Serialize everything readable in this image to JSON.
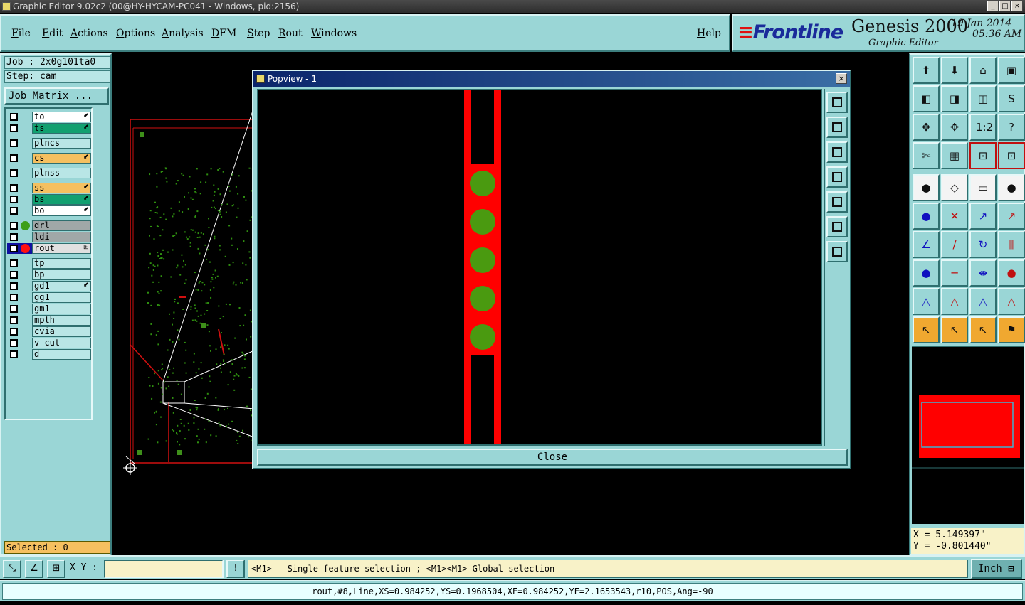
{
  "window": {
    "title": "Graphic Editor 9.02c2 (00@HY-HYCAM-PC041 - Windows, pid:2156)",
    "buttons": [
      "_",
      "□",
      "×"
    ]
  },
  "menu": {
    "items": [
      "File",
      "Edit",
      "Actions",
      "Options",
      "Analysis",
      "DFM",
      "Step",
      "Rout",
      "Windows"
    ],
    "help": "Help"
  },
  "brand": {
    "logo": "Frontline",
    "product": "Genesis 2000",
    "subtitle": "Graphic Editor",
    "date": "19 Jan 2014",
    "time": "05:36 AM"
  },
  "job": {
    "job_label": "Job : 2x0g101ta0",
    "step_label": "Step: cam",
    "matrix_button": "Job Matrix ...",
    "selected": "Selected : 0"
  },
  "layers": [
    {
      "name": "to",
      "color": "#ffffff",
      "mark": "⬋"
    },
    {
      "name": "ts",
      "color": "#12a070",
      "mark": "⬋"
    },
    {
      "name": "plncs",
      "color": "#b9e6e6",
      "mark": ""
    },
    {
      "name": "cs",
      "color": "#f5c060",
      "mark": "⬋"
    },
    {
      "name": "plnss",
      "color": "#b9e6e6",
      "mark": ""
    },
    {
      "name": "ss",
      "color": "#f5c060",
      "mark": "⬋"
    },
    {
      "name": "bs",
      "color": "#12a070",
      "mark": "⬋"
    },
    {
      "name": "bo",
      "color": "#ffffff",
      "mark": "⬋"
    },
    {
      "name": "drl",
      "color": "#a0a8a8",
      "mark": ""
    },
    {
      "name": "ldi",
      "color": "#a0a8a8",
      "mark": ""
    },
    {
      "name": "rout",
      "color": "#e0e0e0",
      "mark": "⊞"
    },
    {
      "name": "tp",
      "color": "#b9e6e6",
      "mark": ""
    },
    {
      "name": "bp",
      "color": "#b9e6e6",
      "mark": ""
    },
    {
      "name": "gd1",
      "color": "#b9e6e6",
      "mark": "⬋"
    },
    {
      "name": "gg1",
      "color": "#b9e6e6",
      "mark": ""
    },
    {
      "name": "gm1",
      "color": "#b9e6e6",
      "mark": ""
    },
    {
      "name": "mpth",
      "color": "#b9e6e6",
      "mark": ""
    },
    {
      "name": "cvia",
      "color": "#b9e6e6",
      "mark": ""
    },
    {
      "name": "v-cut",
      "color": "#b9e6e6",
      "mark": ""
    },
    {
      "name": "d",
      "color": "#b9e6e6",
      "mark": ""
    }
  ],
  "popview": {
    "title": "Popview - 1",
    "close_label": "Close"
  },
  "coords": {
    "x": "X =  5.149397\"",
    "y": "Y = -0.801440\""
  },
  "command": {
    "xy_label": "X Y :",
    "xy_value": "",
    "help": "<M1> - Single feature selection ; <M1><M1> Global selection",
    "unit": "Inch ⊟"
  },
  "status": "rout,#8,Line,XS=0.984252,YS=0.1968504,XE=0.984252,YE=2.1653543,r10,POS,Ang=-90",
  "colors": {
    "panel": "#9ad6d6",
    "rout": "#ff0000",
    "drill": "#4a9a10"
  }
}
